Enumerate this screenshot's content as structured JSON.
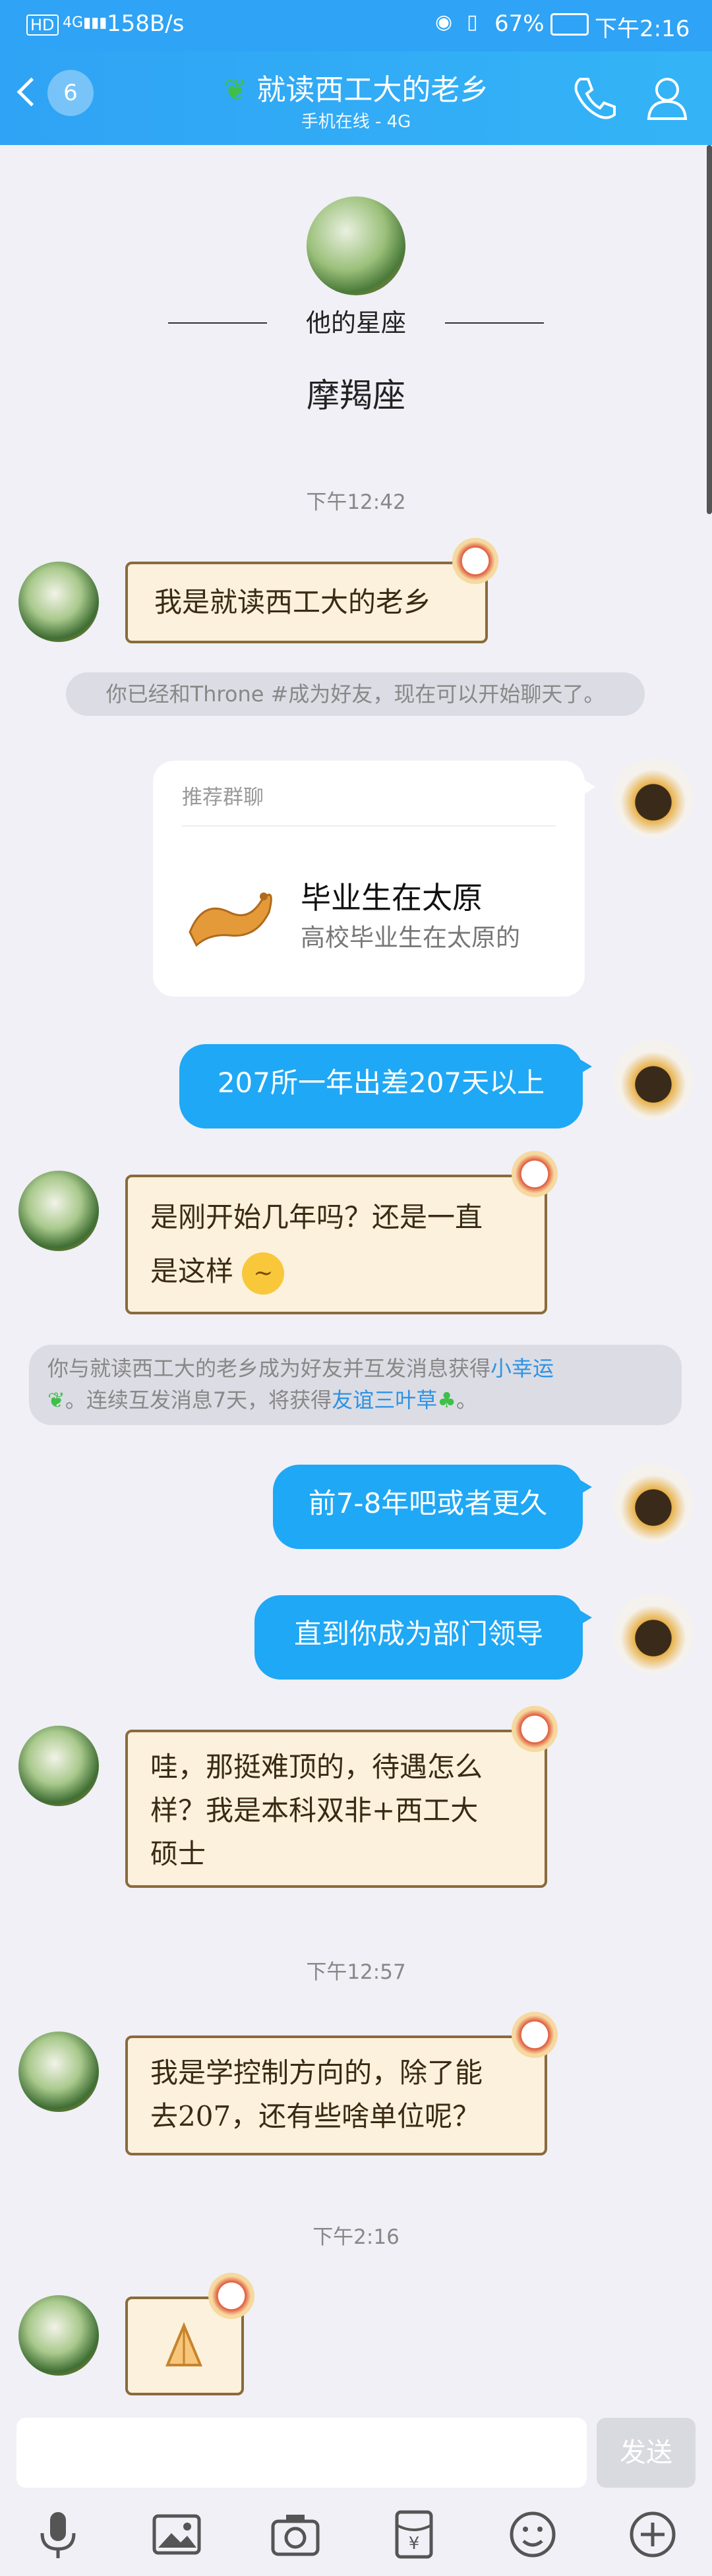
{
  "status_bar": {
    "left_signal_label": "HD",
    "network_speed": "158B/s",
    "battery": "67%",
    "time": "下午2:16"
  },
  "header": {
    "unread_count": "6",
    "title": "就读西工大的老乡",
    "subtitle": "手机在线 - 4G",
    "icons": [
      "back-chevron-icon",
      "phone-icon",
      "profile-icon"
    ]
  },
  "profile": {
    "star_label": "他的星座",
    "star_sign": "摩羯座"
  },
  "times": [
    "下午12:42",
    "下午12:57",
    "下午2:16"
  ],
  "messages": {
    "m1": "我是就读西工大的老乡",
    "sys1": "你已经和Throne #成为好友，现在可以开始聊天了。",
    "card_header": "推荐群聊",
    "card_title": "毕业生在太原",
    "card_desc": "高校毕业生在太原的",
    "m2": "207所一年出差207天以上",
    "m3_line1": "是刚开始几年吗？还是一直",
    "m3_line2": "是这样",
    "sys2_part1": "你与就读西工大的老乡成为好友并互发消息获得",
    "sys2_link1": "小幸运",
    "sys2_part2": "。连续互发消息7天，将获得",
    "sys2_link2": "友谊三叶草",
    "sys2_part3": "。",
    "m4": "前7-8年吧或者更久",
    "m5": "直到你成为部门领导",
    "m6_line1": "哇，那挺难顶的，待遇怎么",
    "m6_line2": "样？我是本科双非+西工大",
    "m6_line3": "硕士",
    "m7_line1": "我是学控制方向的，除了能",
    "m7_line2": "去207，还有些啥单位呢？"
  },
  "input": {
    "placeholder": "",
    "send_label": "发送"
  },
  "toolbar_icons": [
    "microphone-icon",
    "image-icon",
    "camera-icon",
    "red-packet-icon",
    "emoji-icon",
    "plus-icon"
  ],
  "colors": {
    "header_blue": "#2fa3f5",
    "bubble_blue": "#1fa8f5",
    "background": "#f0f0f6",
    "link_blue": "#2b93e5"
  }
}
